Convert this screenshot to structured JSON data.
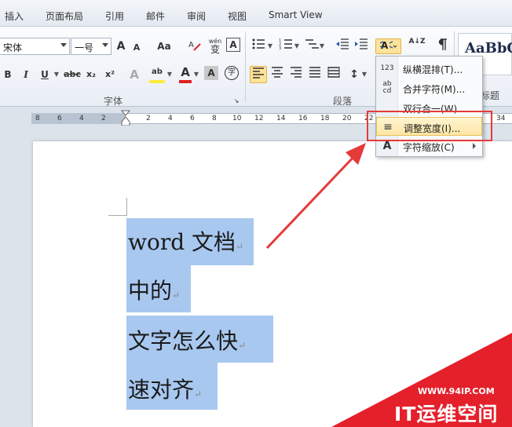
{
  "tabs": [
    "插入",
    "页面布局",
    "引用",
    "邮件",
    "审阅",
    "视图",
    "Smart View"
  ],
  "font": {
    "name": "宋体",
    "size": "一号",
    "grow": "A",
    "shrink": "A",
    "case": "Aa",
    "phonetic": "wén",
    "phonetic_char": "变",
    "border_char": "A",
    "bold": "B",
    "italic": "I",
    "underline": "U",
    "strike": "abc",
    "subscript": "x₂",
    "superscript": "x²",
    "effects": "A",
    "highlight": "ab",
    "color": "A",
    "shade": "A",
    "enclose": "字",
    "group_label": "字体"
  },
  "paragraph": {
    "group_label": "段落",
    "sort": "A↓Z",
    "line_spacing": "↕"
  },
  "styles": {
    "sample": "AaBbC",
    "name": "标题"
  },
  "ruler_numbers": [
    "8",
    "6",
    "4",
    "2",
    "2",
    "4",
    "6",
    "8",
    "10",
    "12",
    "14",
    "16",
    "18",
    "20",
    "22",
    "34"
  ],
  "menu": {
    "items": [
      {
        "icon": "123",
        "label": "纵横混排(T)..."
      },
      {
        "icon": "ab cd",
        "label": "合并字符(M)..."
      },
      {
        "icon": "",
        "label": "双行合一(W)..."
      },
      {
        "icon": "≡",
        "label": "调整宽度(I)..."
      },
      {
        "icon": "A",
        "label": "字符缩放(C)"
      }
    ]
  },
  "document": {
    "lines": [
      "word 文档",
      "中的",
      "文字怎么快",
      "速对齐"
    ],
    "para_mark": "↵"
  },
  "watermark": {
    "url": "WWW.94IP.COM",
    "brand": "IT运维空间"
  },
  "colors": {
    "accent_red": "#e53a3a",
    "selection": "#a8c8f0",
    "highlight_menu": "#fde6a4"
  }
}
